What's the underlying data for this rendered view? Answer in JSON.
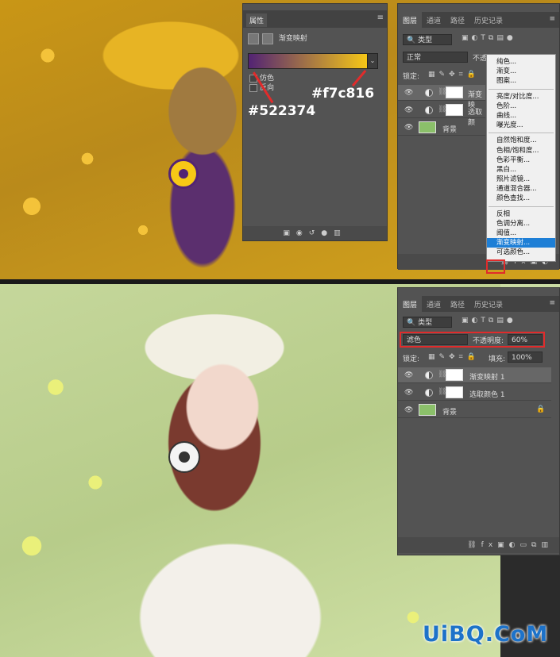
{
  "top": {
    "properties": {
      "tab": "属性",
      "type_label": "渐变映射",
      "dither": "仿色",
      "reverse": "反向"
    },
    "color_labels": {
      "end": "#f7c816",
      "start": "#522374"
    },
    "layers": {
      "tabs": [
        "图层",
        "通道",
        "路径",
        "历史记录"
      ],
      "filter": "类型",
      "blend_mode": "正常",
      "opacity_label": "不透",
      "lock_label": "锁定:",
      "rows": [
        {
          "name": "渐变映",
          "selected": true
        },
        {
          "name": "选取颜",
          "selected": false
        },
        {
          "name": "背景",
          "selected": false
        }
      ]
    },
    "menu": {
      "groups": [
        [
          "纯色...",
          "渐变...",
          "图案..."
        ],
        [
          "亮度/对比度...",
          "色阶...",
          "曲线...",
          "曝光度..."
        ],
        [
          "自然饱和度...",
          "色相/饱和度...",
          "色彩平衡...",
          "黑白...",
          "照片滤镜...",
          "通道混合器...",
          "颜色查找..."
        ],
        [
          "反相",
          "色调分离...",
          "阈值...",
          "渐变映射...",
          "可选颜色..."
        ]
      ],
      "highlighted": "渐变映射..."
    }
  },
  "bottom": {
    "layers": {
      "tabs": [
        "图层",
        "通道",
        "路径",
        "历史记录"
      ],
      "filter": "类型",
      "blend_mode": "滤色",
      "opacity_label": "不透明度:",
      "opacity_value": "60%",
      "lock_label": "锁定:",
      "fill_label": "填充:",
      "fill_value": "100%",
      "rows": [
        {
          "name": "渐变映射 1",
          "selected": true
        },
        {
          "name": "选取颜色 1",
          "selected": false
        },
        {
          "name": "背景",
          "selected": false
        }
      ]
    }
  },
  "watermark": "UiBQ.CoM",
  "colors": {
    "gradient_start": "#522374",
    "gradient_end": "#f7c816",
    "highlight": "#1e7fd6",
    "annotation": "#e12b2b"
  }
}
